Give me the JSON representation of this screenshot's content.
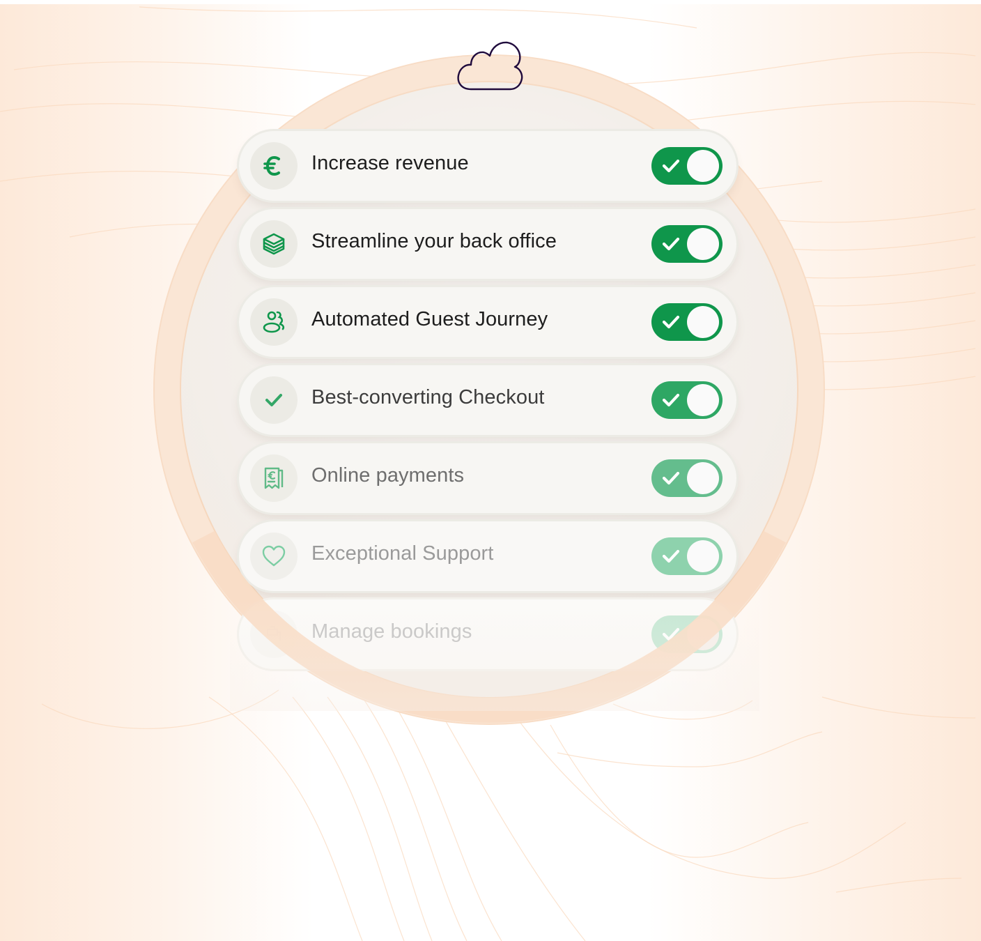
{
  "header": {
    "icon": "cloud-icon",
    "icon_color": "#1f0a3c"
  },
  "features": [
    {
      "label": "Increase revenue",
      "icon": "euro-icon",
      "enabled": true,
      "opacity": 1.0
    },
    {
      "label": "Streamline your back office",
      "icon": "layers-stack-icon",
      "enabled": true,
      "opacity": 1.0
    },
    {
      "label": "Automated Guest Journey",
      "icon": "users-icon",
      "enabled": true,
      "opacity": 1.0
    },
    {
      "label": "Best-converting Checkout",
      "icon": "checkmark-icon",
      "enabled": true,
      "opacity": 0.85
    },
    {
      "label": "Online payments",
      "icon": "receipt-euro-icon",
      "enabled": true,
      "opacity": 0.62
    },
    {
      "label": "Exceptional Support",
      "icon": "heart-icon",
      "enabled": true,
      "opacity": 0.45
    },
    {
      "label": "Manage bookings",
      "icon": "booking-icon",
      "enabled": true,
      "opacity": 0.22
    }
  ],
  "colors": {
    "toggle_on": "#0f964b",
    "icon_green": "#0f964b",
    "label_text": "#1d1d1d",
    "ring_peach": "#f6d7bd",
    "background_peach": "#fde9d9"
  }
}
